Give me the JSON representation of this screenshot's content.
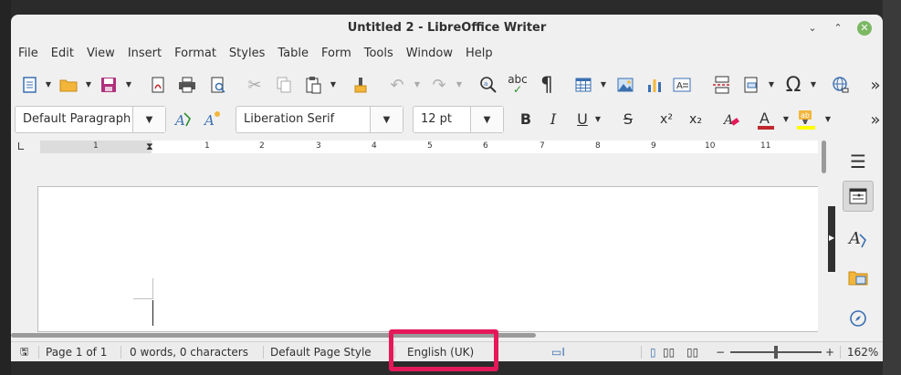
{
  "window": {
    "title": "Untitled 2 - LibreOffice Writer",
    "minimize_glyph": "⌄",
    "maximize_glyph": "⌃",
    "close_glyph": "✕"
  },
  "menu": [
    "File",
    "Edit",
    "View",
    "Insert",
    "Format",
    "Styles",
    "Table",
    "Form",
    "Tools",
    "Window",
    "Help"
  ],
  "toolbar_standard": {
    "icons": [
      "new-document-icon",
      "open-folder-icon",
      "save-icon",
      "export-pdf-icon",
      "print-icon",
      "print-preview-icon",
      "cut-icon",
      "copy-icon",
      "paste-icon",
      "clone-formatting-icon",
      "undo-icon",
      "redo-icon",
      "find-replace-icon",
      "spellcheck-icon",
      "formatting-marks-icon",
      "insert-table-icon",
      "insert-image-icon",
      "insert-chart-icon",
      "insert-textbox-icon",
      "page-break-icon",
      "insert-field-icon",
      "special-character-icon",
      "hyperlink-icon"
    ],
    "spellcheck_label": "abc",
    "more_glyph": "»"
  },
  "toolbar_formatting": {
    "paragraph_style": "Default Paragraph",
    "font_name": "Liberation Serif",
    "font_size": "12 pt",
    "bold": "B",
    "italic": "I",
    "underline": "U",
    "strikethrough": "S",
    "superscript": "x²",
    "subscript": "x₂",
    "more_glyph": "»"
  },
  "ruler": {
    "labels": [
      "1",
      "1",
      "2",
      "3",
      "4",
      "5",
      "6",
      "7",
      "8",
      "9",
      "10",
      "11"
    ]
  },
  "colors": {
    "font_color": "#c0282d",
    "highlight_color": "#ffff00",
    "accent": "#3a6fb0",
    "annotation_highlight": "#e5195a"
  },
  "statusbar": {
    "page": "Page 1 of 1",
    "words": "0 words, 0 characters",
    "page_style": "Default Page Style",
    "language": "English (UK)",
    "zoom": "162%",
    "zoom_minus": "−",
    "zoom_plus": "+"
  }
}
